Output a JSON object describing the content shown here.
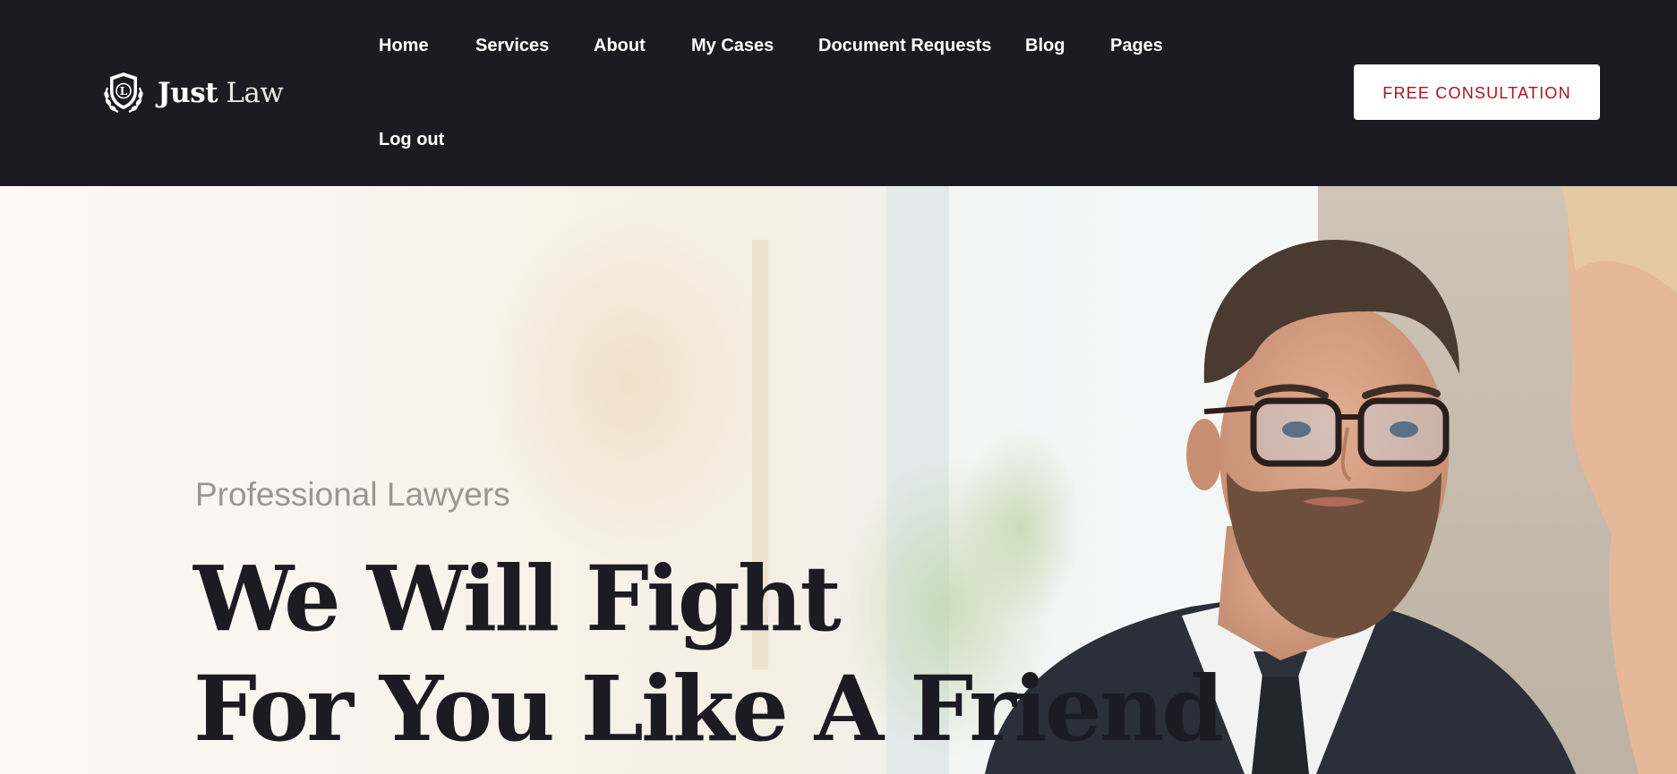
{
  "brand": {
    "name_strong": "Just",
    "name_light": "Law",
    "emblem_letter": "L",
    "icon": "shield-laurel-icon"
  },
  "nav": {
    "items": [
      {
        "label": "Home"
      },
      {
        "label": "Services"
      },
      {
        "label": "About"
      },
      {
        "label": "My Cases"
      },
      {
        "label": "Document Requests"
      },
      {
        "label": "Blog"
      },
      {
        "label": "Pages"
      },
      {
        "label": "Log out"
      }
    ]
  },
  "cta": {
    "label": "FREE CONSULTATION"
  },
  "hero": {
    "subtitle": "Professional Lawyers",
    "heading_line1": "We Will Fight",
    "heading_line2": "For You Like A Friend",
    "image": "lawyer-portrait-photo"
  },
  "colors": {
    "header_bg": "#1c1b23",
    "accent": "#a9141e",
    "heading_text": "#1c1b23",
    "subtitle_text": "#9a9792",
    "hero_bg": "#fbf8f4"
  }
}
